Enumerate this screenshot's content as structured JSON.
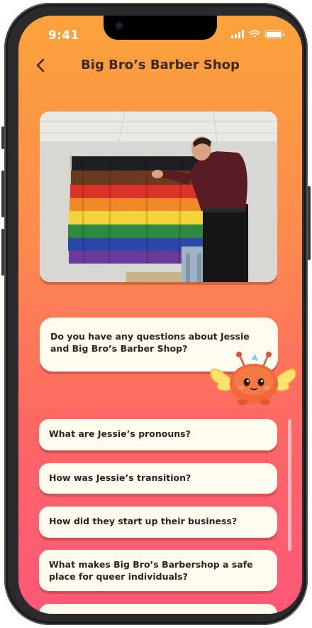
{
  "status_bar": {
    "time": "9:41"
  },
  "header": {
    "title": "Big Bro’s Barber Shop"
  },
  "question_card": {
    "text": "Do you have any questions about Jessie and Big Bro’s Barber Shop?"
  },
  "options": [
    {
      "label": "What are Jessie’s pronouns?"
    },
    {
      "label": "How was Jessie’s transition?"
    },
    {
      "label": "How did they start up their business?"
    },
    {
      "label": "What makes Big Bro’s Barbershop a safe place for queer individuals?"
    }
  ],
  "icons": {
    "back": "chevron-left-icon",
    "signal": "signal-icon",
    "wifi": "wifi-icon",
    "battery": "battery-icon"
  },
  "colors": {
    "gradient_top": "#FCA33C",
    "gradient_bottom": "#FD5878",
    "card_background": "#FFFCEF",
    "text_dark": "#2c2420",
    "mascot_body": "#F2683A",
    "mascot_wings": "#FDE36B"
  }
}
